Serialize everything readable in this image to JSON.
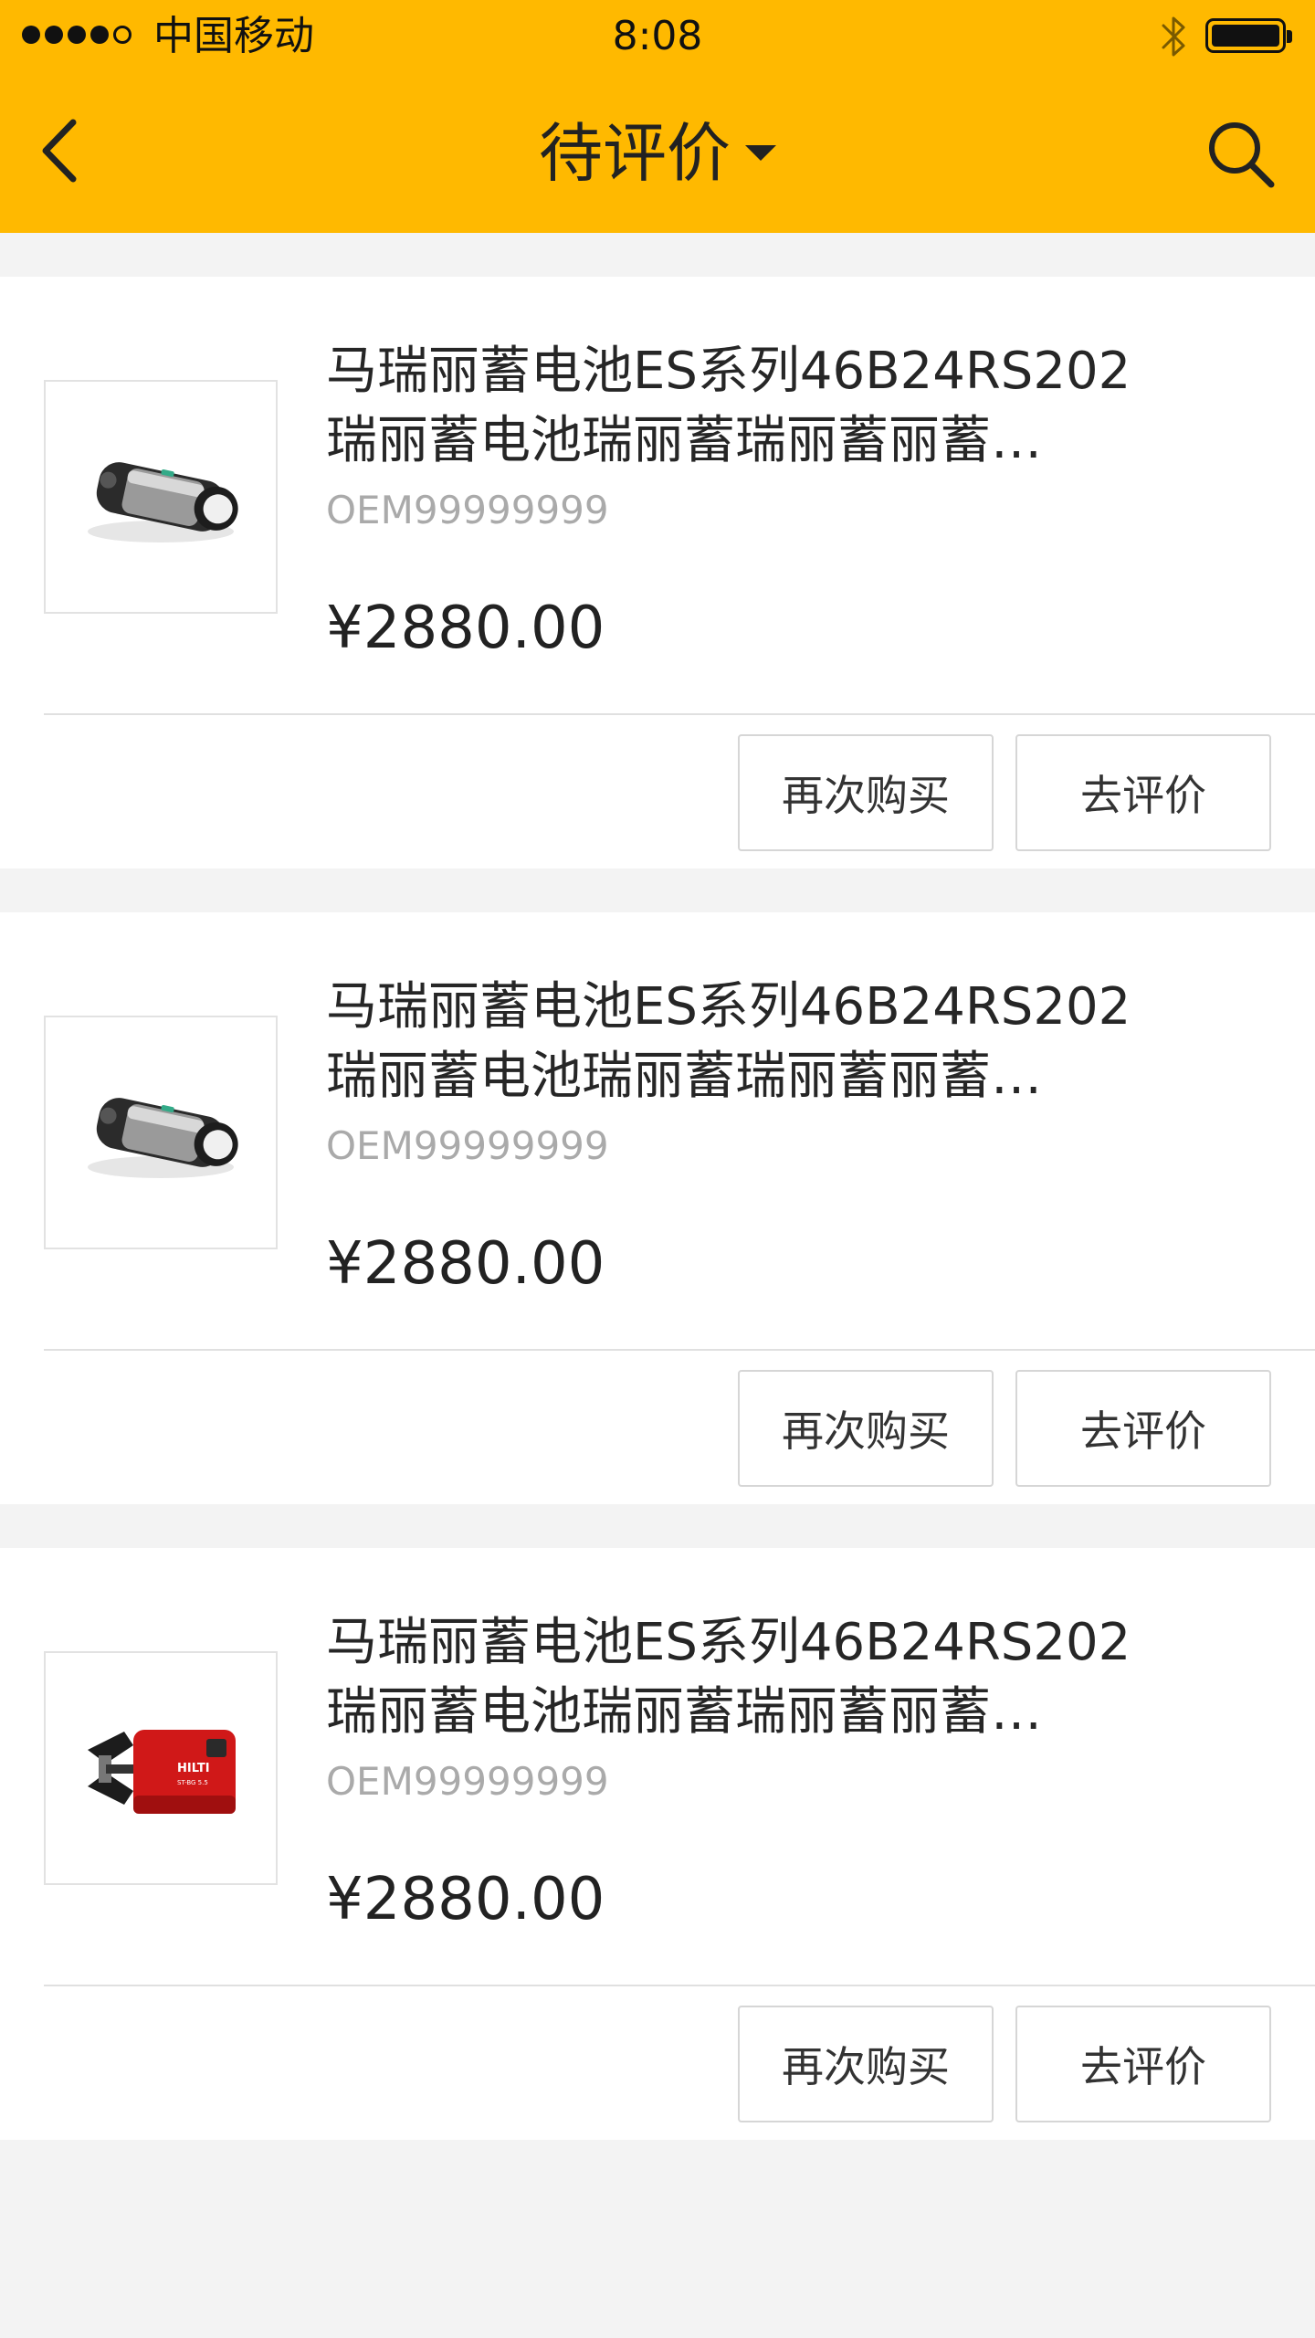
{
  "status_bar": {
    "carrier": "中国移动",
    "time": "8:08",
    "icons": [
      "signal-dots",
      "bluetooth-icon",
      "battery-icon"
    ]
  },
  "nav": {
    "title": "待评价",
    "icons": [
      "back-chevron-icon",
      "caret-down-icon",
      "search-icon"
    ]
  },
  "colors": {
    "header_bg": "#ffb900",
    "page_bg": "#f3f3f3",
    "card_bg": "#ffffff",
    "code_text": "#aaaaaa"
  },
  "orders": [
    {
      "title_line1": "马瑞丽蓄电池ES系列46B24RS202",
      "title_line2": "瑞丽蓄电池瑞丽蓄瑞丽蓄丽蓄…",
      "code": "OEM99999999",
      "price": "¥2880.00",
      "image": "camera-product-image",
      "buy_again_label": "再次购买",
      "review_label": "去评价"
    },
    {
      "title_line1": "马瑞丽蓄电池ES系列46B24RS202",
      "title_line2": "瑞丽蓄电池瑞丽蓄瑞丽蓄丽蓄…",
      "code": "OEM99999999",
      "price": "¥2880.00",
      "image": "camera-product-image",
      "buy_again_label": "再次购买",
      "review_label": "去评价"
    },
    {
      "title_line1": "马瑞丽蓄电池ES系列46B24RS202",
      "title_line2": "瑞丽蓄电池瑞丽蓄瑞丽蓄丽蓄…",
      "code": "OEM99999999",
      "price": "¥2880.00",
      "image": "power-tool-product-image",
      "buy_again_label": "再次购买",
      "review_label": "去评价"
    }
  ]
}
